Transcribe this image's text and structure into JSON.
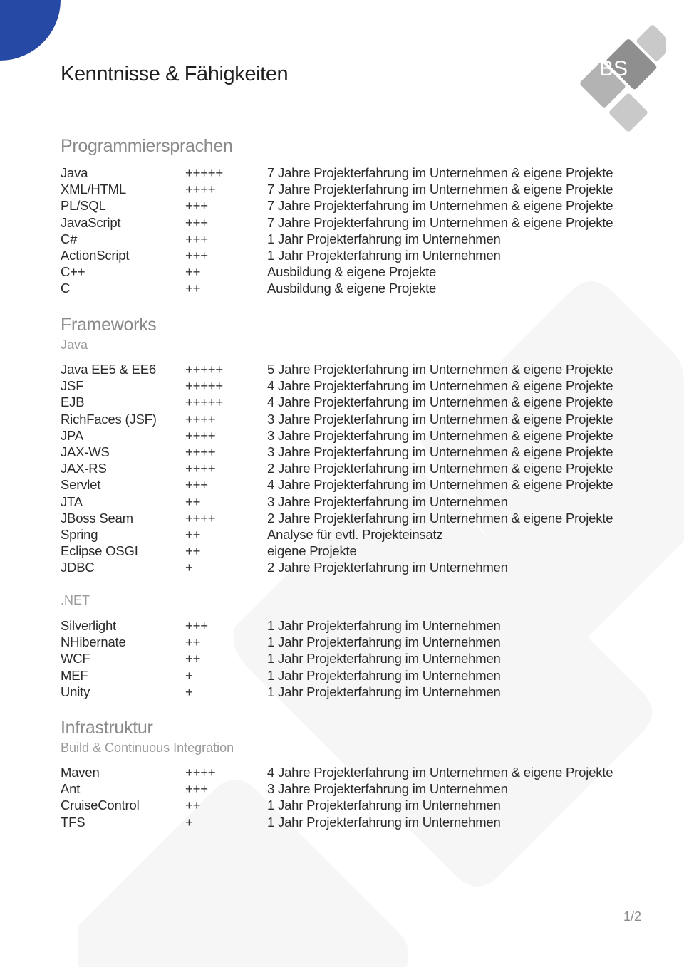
{
  "page": {
    "title": "Kenntnisse & Fähigkeiten",
    "page_number": "1/2",
    "accent_color": "#2549a4",
    "logo_text": "BS"
  },
  "sections": {
    "programming": {
      "title": "Programmiersprachen",
      "rows": [
        {
          "name": "Java",
          "level": "+++++",
          "desc": "7 Jahre Projekterfahrung im Unternehmen & eigene Projekte"
        },
        {
          "name": "XML/HTML",
          "level": "++++",
          "desc": "7 Jahre Projekterfahrung im Unternehmen & eigene Projekte"
        },
        {
          "name": "PL/SQL",
          "level": "+++",
          "desc": "7 Jahre Projekterfahrung im Unternehmen & eigene Projekte"
        },
        {
          "name": "JavaScript",
          "level": "+++",
          "desc": "7 Jahre Projekterfahrung im Unternehmen & eigene Projekte"
        },
        {
          "name": "C#",
          "level": "+++",
          "desc": "1 Jahr Projekterfahrung im Unternehmen"
        },
        {
          "name": "ActionScript",
          "level": "+++",
          "desc": "1 Jahr Projekterfahrung im Unternehmen"
        },
        {
          "name": "C++",
          "level": "++",
          "desc": "Ausbildung & eigene Projekte"
        },
        {
          "name": "C",
          "level": "++",
          "desc": "Ausbildung & eigene Projekte"
        }
      ]
    },
    "frameworks": {
      "title": "Frameworks",
      "java": {
        "subtitle": "Java",
        "rows": [
          {
            "name": "Java EE5 & EE6",
            "level": "+++++",
            "desc": "5 Jahre Projekterfahrung im Unternehmen & eigene Projekte"
          },
          {
            "name": "JSF",
            "level": "+++++",
            "desc": "4 Jahre Projekterfahrung im Unternehmen & eigene Projekte"
          },
          {
            "name": "EJB",
            "level": "+++++",
            "desc": "4 Jahre Projekterfahrung im Unternehmen & eigene Projekte"
          },
          {
            "name": "RichFaces (JSF)",
            "level": "++++",
            "desc": "3 Jahre Projekterfahrung im Unternehmen & eigene Projekte"
          },
          {
            "name": "JPA",
            "level": "++++",
            "desc": "3 Jahre Projekterfahrung im Unternehmen & eigene Projekte"
          },
          {
            "name": "JAX-WS",
            "level": "++++",
            "desc": "3 Jahre Projekterfahrung im Unternehmen & eigene Projekte"
          },
          {
            "name": "JAX-RS",
            "level": "++++",
            "desc": "2 Jahre Projekterfahrung im Unternehmen & eigene Projekte"
          },
          {
            "name": "Servlet",
            "level": "+++",
            "desc": "4 Jahre Projekterfahrung im Unternehmen & eigene Projekte"
          },
          {
            "name": "JTA",
            "level": "++",
            "desc": "3 Jahre Projekterfahrung im Unternehmen"
          },
          {
            "name": "JBoss Seam",
            "level": "++++",
            "desc": "2 Jahre Projekterfahrung im Unternehmen & eigene Projekte"
          },
          {
            "name": "Spring",
            "level": "++",
            "desc": "Analyse für evtl. Projekteinsatz"
          },
          {
            "name": "Eclipse OSGI",
            "level": "++",
            "desc": "eigene Projekte"
          },
          {
            "name": "JDBC",
            "level": "+",
            "desc": "2 Jahre Projekterfahrung im Unternehmen"
          }
        ]
      },
      "dotnet": {
        "subtitle": ".NET",
        "rows": [
          {
            "name": "Silverlight",
            "level": "+++",
            "desc": "1 Jahr Projekterfahrung im Unternehmen"
          },
          {
            "name": "NHibernate",
            "level": "++",
            "desc": "1 Jahr Projekterfahrung im Unternehmen"
          },
          {
            "name": "WCF",
            "level": "++",
            "desc": "1 Jahr Projekterfahrung im Unternehmen"
          },
          {
            "name": "MEF",
            "level": "+",
            "desc": "1 Jahr Projekterfahrung im Unternehmen"
          },
          {
            "name": "Unity",
            "level": "+",
            "desc": "1 Jahr Projekterfahrung im Unternehmen"
          }
        ]
      }
    },
    "infrastructure": {
      "title": "Infrastruktur",
      "subtitle": "Build & Continuous Integration",
      "rows": [
        {
          "name": "Maven",
          "level": "++++",
          "desc": "4 Jahre Projekterfahrung im Unternehmen & eigene Projekte"
        },
        {
          "name": "Ant",
          "level": "+++",
          "desc": "3 Jahre Projekterfahrung im Unternehmen"
        },
        {
          "name": "CruiseControl",
          "level": "++",
          "desc": "1 Jahr Projekterfahrung im Unternehmen"
        },
        {
          "name": "TFS",
          "level": "+",
          "desc": "1 Jahr Projekterfahrung im Unternehmen"
        }
      ]
    }
  }
}
